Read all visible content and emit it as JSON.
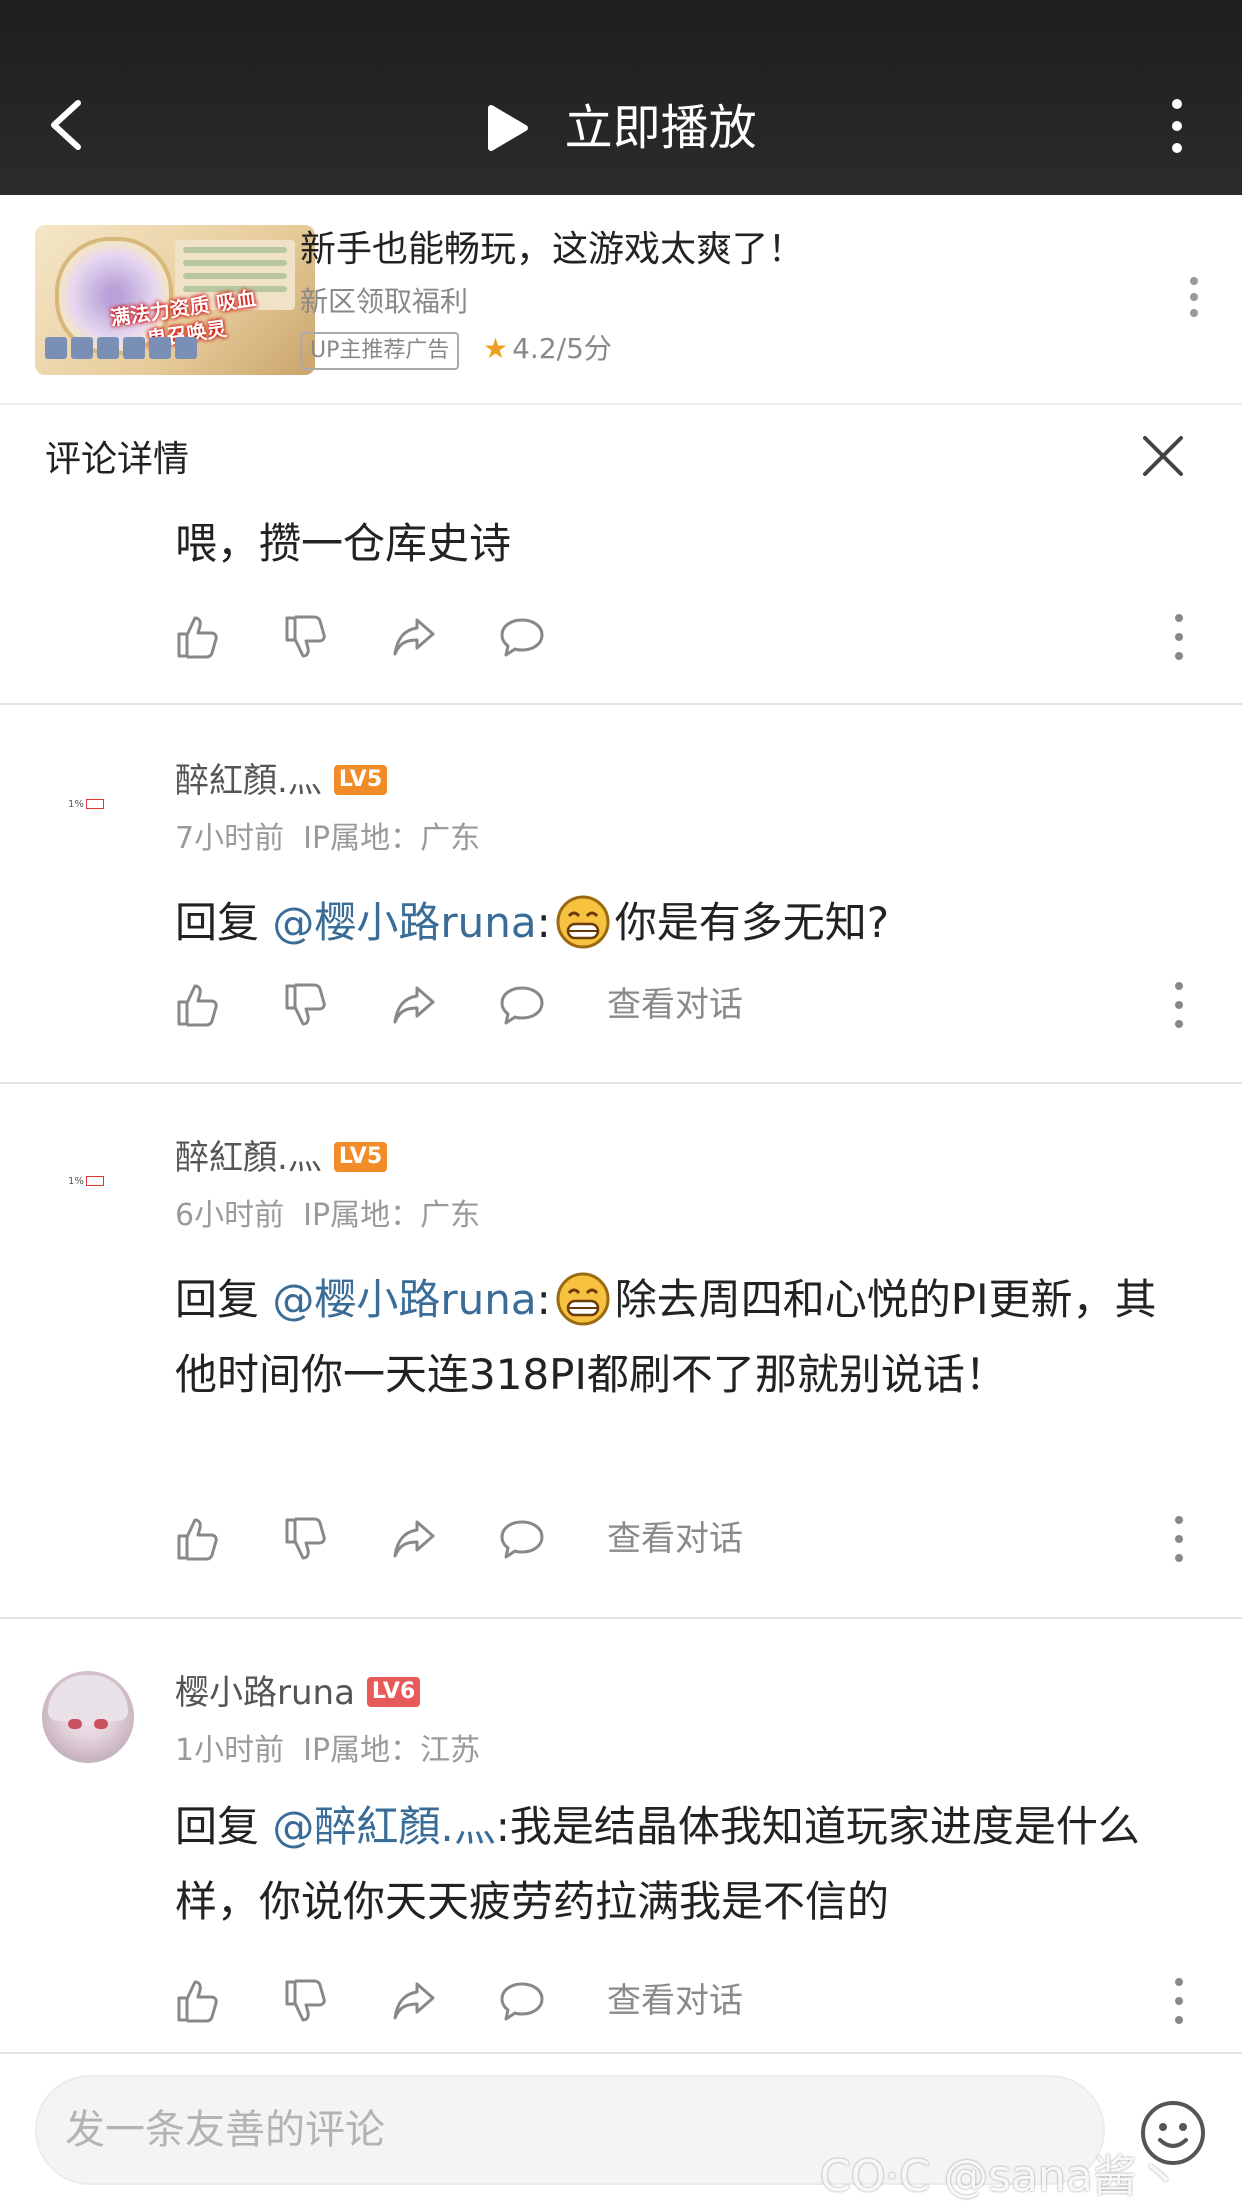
{
  "header": {
    "play_label": "立即播放"
  },
  "ad": {
    "title": "新手也能畅玩，这游戏太爽了！",
    "subtitle": "新区领取福利",
    "tag": "UP主推荐广告",
    "rating": "4.2/5分",
    "thumb_text": "满法力资质 吸血鬼召唤灵"
  },
  "detail": {
    "title": "评论详情",
    "root_comment": "喂，攒一仓库史诗"
  },
  "comments": [
    {
      "username": "醉紅顏.灬",
      "level": "LV5",
      "level_color": "#f28c28",
      "time": "7小时前",
      "ip": "IP属地：广东",
      "reply_prefix": "回复",
      "mention": "@樱小路runa",
      "colon": ":",
      "text": "你是有多无知?",
      "view_label": "查看对话"
    },
    {
      "username": "醉紅顏.灬",
      "level": "LV5",
      "level_color": "#f28c28",
      "time": "6小时前",
      "ip": "IP属地：广东",
      "reply_prefix": "回复",
      "mention": "@樱小路runa",
      "colon": ":",
      "text": "除去周四和心悦的PI更新，其他时间你一天连318PI都刷不了那就别说话！",
      "view_label": "查看对话"
    },
    {
      "username": "樱小路runa",
      "level": "LV6",
      "level_color": "#e85a5a",
      "time": "1小时前",
      "ip": "IP属地：江苏",
      "reply_prefix": "回复",
      "mention": "@醉紅顏.灬",
      "colon": ":",
      "text": "我是结晶体我知道玩家进度是什么样，你说你天天疲劳药拉满我是不信的",
      "view_label": "查看对话"
    }
  ],
  "input": {
    "placeholder": "发一条友善的评论"
  },
  "watermark": "CO·C @sana酱丶",
  "icons": [
    "back-icon",
    "play-icon",
    "more-icon",
    "close-icon",
    "like-icon",
    "dislike-icon",
    "share-icon",
    "reply-icon",
    "emoji-icon"
  ]
}
